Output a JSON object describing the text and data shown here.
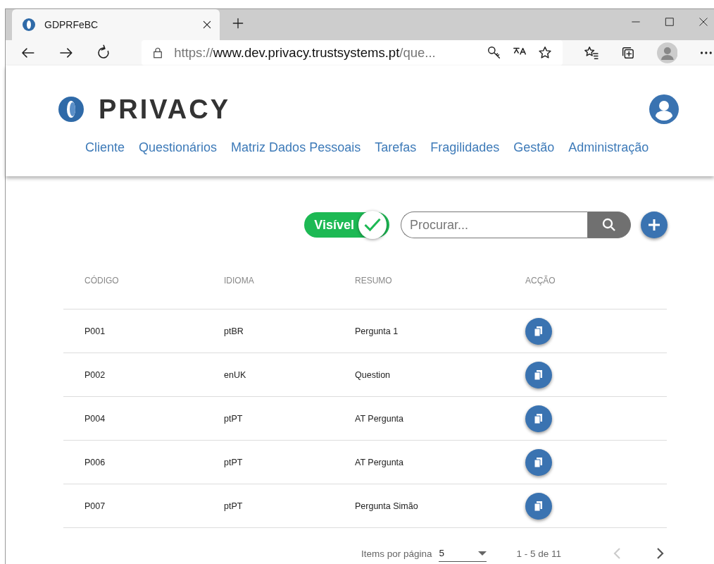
{
  "browser": {
    "tab_title": "GDPRFeBC",
    "url": {
      "scheme": "https://",
      "host": "www.dev.privacy.trustsystems.pt",
      "path": "/que..."
    }
  },
  "header": {
    "logo_text": "PRIVACY",
    "nav": [
      "Cliente",
      "Questionários",
      "Matriz Dados Pessoais",
      "Tarefas",
      "Fragilidades",
      "Gestão",
      "Administração"
    ]
  },
  "toolbar": {
    "toggle": {
      "label": "Visível",
      "on": true
    },
    "search": {
      "placeholder": "Procurar..."
    }
  },
  "table": {
    "columns": [
      "CÓDIGO",
      "IDIOMA",
      "RESUMO",
      "ACÇÃO"
    ],
    "rows": [
      {
        "code": "P001",
        "language": "ptBR",
        "summary": "Pergunta 1"
      },
      {
        "code": "P002",
        "language": "enUK",
        "summary": "Question"
      },
      {
        "code": "P004",
        "language": "ptPT",
        "summary": "AT Pergunta"
      },
      {
        "code": "P006",
        "language": "ptPT",
        "summary": "AT Pergunta"
      },
      {
        "code": "P007",
        "language": "ptPT",
        "summary": "Pergunta Simão"
      }
    ]
  },
  "paginator": {
    "label": "Items por página",
    "page_size": "5",
    "range": "1 - 5 de 11",
    "prev_disabled": true,
    "next_disabled": false
  }
}
